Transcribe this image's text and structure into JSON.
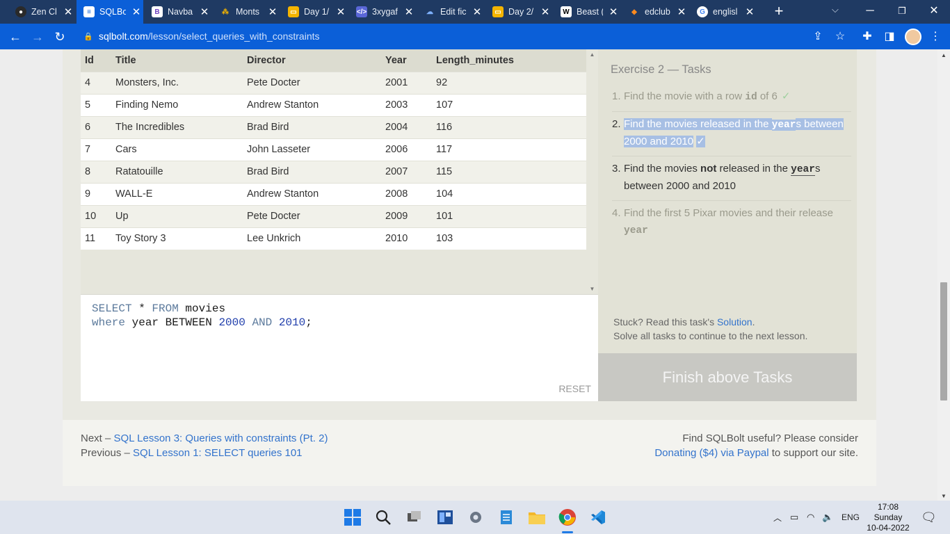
{
  "browser": {
    "tabs": [
      {
        "label": "Zen Cl",
        "icon": "zen-icon"
      },
      {
        "label": "SQLBo",
        "icon": "sqlbolt-icon",
        "active": true
      },
      {
        "label": "Navba",
        "icon": "bootstrap-icon"
      },
      {
        "label": "Monts",
        "icon": "monday-icon"
      },
      {
        "label": "Day 1/",
        "icon": "slides-icon"
      },
      {
        "label": "3xygaf",
        "icon": "code-icon"
      },
      {
        "label": "Edit fic",
        "icon": "cloud-icon"
      },
      {
        "label": "Day 2/",
        "icon": "slides-icon"
      },
      {
        "label": "Beast (",
        "icon": "w-icon"
      },
      {
        "label": "edclub",
        "icon": "edclub-icon"
      },
      {
        "label": "englisl",
        "icon": "google-icon"
      }
    ],
    "url_host": "sqlbolt.com",
    "url_path": "/lesson/select_queries_with_constraints"
  },
  "results_table": {
    "columns": [
      "Id",
      "Title",
      "Director",
      "Year",
      "Length_minutes"
    ],
    "rows": [
      [
        "4",
        "Monsters, Inc.",
        "Pete Docter",
        "2001",
        "92"
      ],
      [
        "5",
        "Finding Nemo",
        "Andrew Stanton",
        "2003",
        "107"
      ],
      [
        "6",
        "The Incredibles",
        "Brad Bird",
        "2004",
        "116"
      ],
      [
        "7",
        "Cars",
        "John Lasseter",
        "2006",
        "117"
      ],
      [
        "8",
        "Ratatouille",
        "Brad Bird",
        "2007",
        "115"
      ],
      [
        "9",
        "WALL-E",
        "Andrew Stanton",
        "2008",
        "104"
      ],
      [
        "10",
        "Up",
        "Pete Docter",
        "2009",
        "101"
      ],
      [
        "11",
        "Toy Story 3",
        "Lee Unkrich",
        "2010",
        "103"
      ]
    ]
  },
  "editor": {
    "line1": {
      "kw1": "SELECT",
      "star": " * ",
      "kw2": "FROM",
      "rest": " movies"
    },
    "line2": {
      "kw1": "where",
      "mid": " year BETWEEN ",
      "n1": "2000",
      "kw2": " AND ",
      "n2": "2010",
      "end": ";"
    },
    "reset_label": "RESET"
  },
  "tasks": {
    "heading": "Exercise 2 — Tasks",
    "items": [
      {
        "num": "1.",
        "pre": "Find the movie with a row ",
        "code": "id",
        "post": " of 6",
        "check": "✓"
      },
      {
        "num": "2.",
        "pre": "Find the movies released in the ",
        "code": "year",
        "post": "s between 2000 and 2010",
        "check": "✓"
      },
      {
        "num": "3.",
        "pre": "Find the movies ",
        "bold": "not",
        "mid": " released in the ",
        "code": "year",
        "post": "s between 2000 and 2010"
      },
      {
        "num": "4.",
        "pre": "Find the first 5 Pixar movies and their release ",
        "code": "year"
      }
    ],
    "stuck_pre": "Stuck? Read this task's ",
    "stuck_link": "Solution",
    "stuck_post": ".",
    "solve_all": "Solve all tasks to continue to the next lesson.",
    "finish_label": "Finish above Tasks"
  },
  "footer": {
    "next_pre": "Next – ",
    "next_link": "SQL Lesson 3: Queries with constraints (Pt. 2)",
    "prev_pre": "Previous – ",
    "prev_link": "SQL Lesson 1: SELECT queries 101",
    "useful": "Find SQLBolt useful? Please consider",
    "donate_link": "Donating ($4) via Paypal",
    "donate_post": " to support our site."
  },
  "taskbar": {
    "lang": "ENG",
    "time": "17:08",
    "day": "Sunday",
    "date": "10-04-2022"
  }
}
